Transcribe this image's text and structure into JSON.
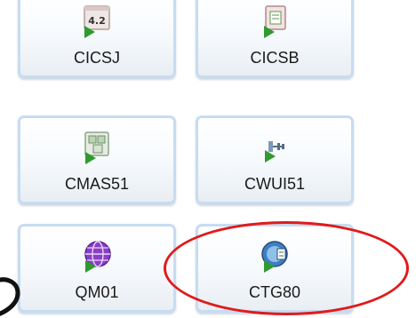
{
  "tiles": [
    {
      "label": "CICSJ",
      "icon": "cics-java-icon",
      "badge": "4.2"
    },
    {
      "label": "CICSB",
      "icon": "cics-bundle-icon"
    },
    {
      "label": "CMAS51",
      "icon": "cmas-icon"
    },
    {
      "label": "CWUI51",
      "icon": "cwui-icon"
    },
    {
      "label": "QM01",
      "icon": "queue-manager-globe-icon"
    },
    {
      "label": "CTG80",
      "icon": "transaction-gateway-icon"
    }
  ],
  "colors": {
    "tile_border": "#c7dcf1",
    "highlight": "#e01b1b",
    "play_arrow": "#2f9a2f"
  }
}
